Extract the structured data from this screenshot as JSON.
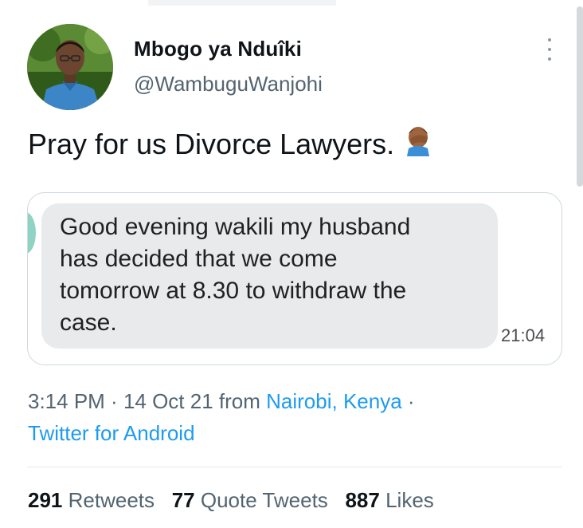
{
  "author": {
    "display_name": "Mbogo ya Nduîki",
    "handle": "@WambuguWanjohi"
  },
  "tweet": {
    "text": "Pray for us Divorce Lawyers.",
    "emoji": "facepalm-emoji"
  },
  "media": {
    "message_lines": [
      "Good evening wakili my husband",
      "has decided that we come",
      "tomorrow at 8.30 to withdraw the",
      "case."
    ],
    "message_time": "21:04"
  },
  "meta": {
    "time": "3:14 PM",
    "separator": " · ",
    "date": "14 Oct 21",
    "from_label": " from ",
    "location": "Nairobi, Kenya",
    "trailing_separator": " ·",
    "source": "Twitter for Android"
  },
  "stats": {
    "retweets_count": "291",
    "retweets_label": "Retweets",
    "quote_tweets_count": "77",
    "quote_tweets_label": "Quote Tweets",
    "likes_count": "887",
    "likes_label": "Likes"
  },
  "colors": {
    "link": "#1d9bf0",
    "secondary_text": "#536471",
    "bubble": "#e9eaec"
  }
}
